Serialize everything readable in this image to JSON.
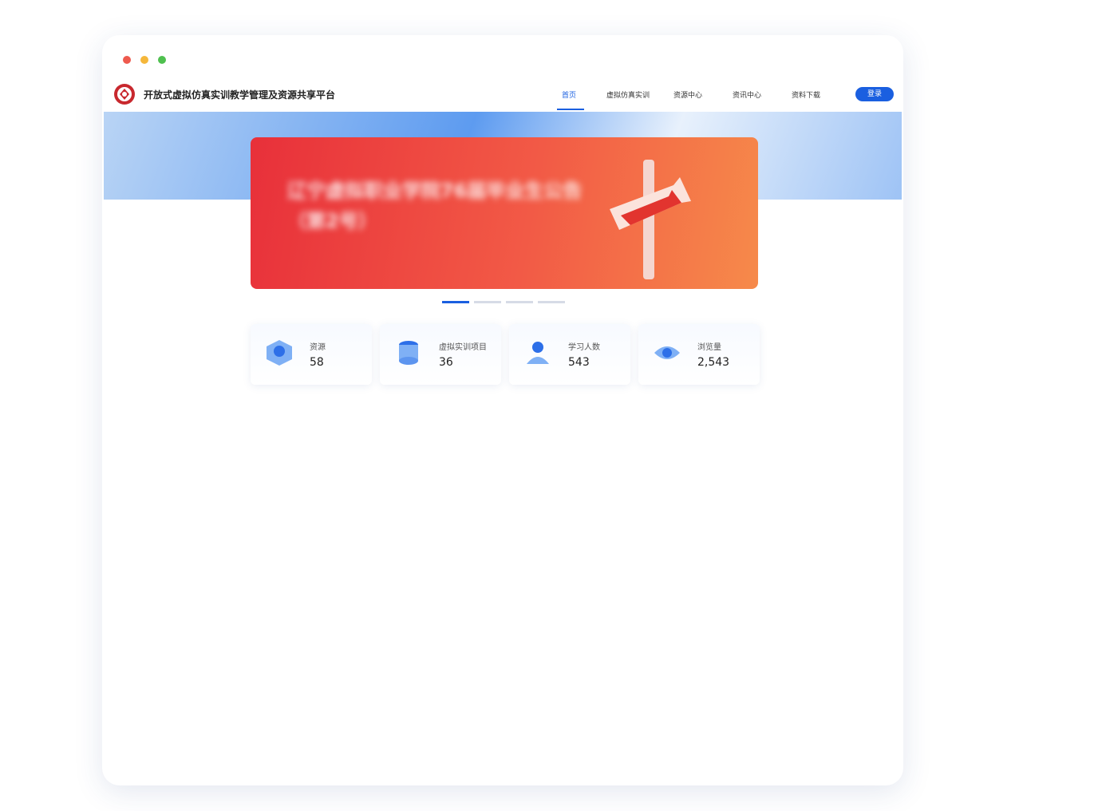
{
  "site_title": "开放式虚拟仿真实训教学管理及资源共享平台",
  "nav": [
    "首页",
    "虚拟仿真实训",
    "资源中心",
    "资讯中心",
    "资料下载"
  ],
  "login_label": "登录",
  "banner_text_line1": "辽宁虚拟职业学院76届毕业生公告",
  "banner_text_line2": "（第2号）",
  "stats": [
    {
      "label": "资源",
      "value": "58"
    },
    {
      "label": "虚拟实训项目",
      "value": "36"
    },
    {
      "label": "学习人数",
      "value": "543"
    },
    {
      "label": "浏览量",
      "value": "2,543"
    }
  ],
  "colors": {
    "accent": "#1a5fe0",
    "red": "#e43b3b",
    "green": "#19b06b",
    "orange": "#f4a12c",
    "gray": "#aab3c2"
  }
}
